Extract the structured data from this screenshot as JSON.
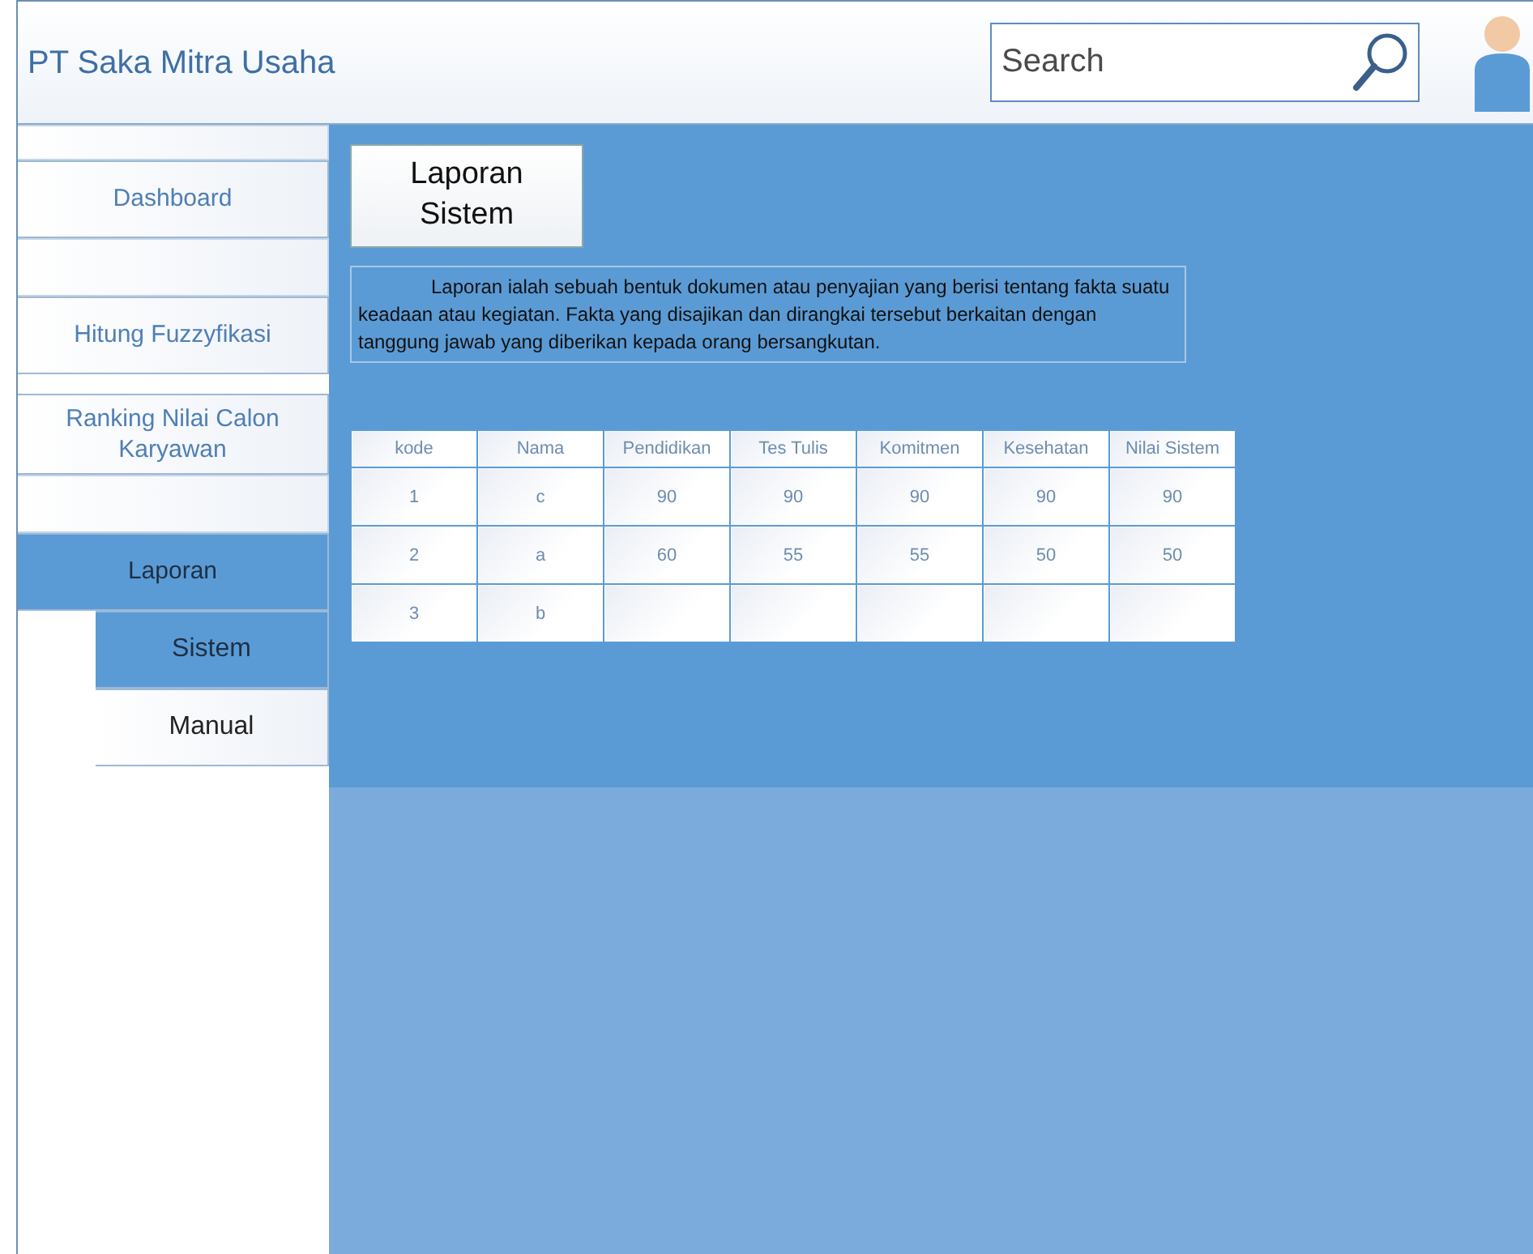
{
  "header": {
    "title": "PT Saka Mitra Usaha",
    "search": {
      "placeholder": "Search"
    }
  },
  "sidebar": {
    "items": [
      {
        "kind": "blank"
      },
      {
        "kind": "item",
        "label": "Dashboard",
        "selected": false
      },
      {
        "kind": "blank"
      },
      {
        "kind": "item",
        "label": "Hitung Fuzzyfikasi",
        "selected": false
      },
      {
        "kind": "item",
        "label": "Ranking Nilai Calon Karyawan",
        "selected": false
      },
      {
        "kind": "blank"
      },
      {
        "kind": "item",
        "label": "Laporan",
        "selected": true,
        "children": [
          {
            "label": "Sistem",
            "selected": true
          },
          {
            "label": "Manual",
            "selected": false
          }
        ]
      }
    ]
  },
  "content": {
    "title": "Laporan Sistem",
    "description": "Laporan ialah sebuah bentuk dokumen atau penyajian yang berisi tentang fakta suatu keadaan atau kegiatan. Fakta yang disajikan dan dirangkai tersebut berkaitan dengan tanggung jawab yang diberikan kepada orang bersangkutan.",
    "table": {
      "columns": [
        "kode",
        "Nama",
        "Pendidikan",
        "Tes Tulis",
        "Komitmen",
        "Kesehatan",
        "Nilai Sistem"
      ],
      "rows": [
        [
          "1",
          "c",
          "90",
          "90",
          "90",
          "90",
          "90"
        ],
        [
          "2",
          "a",
          "60",
          "55",
          "55",
          "50",
          "50"
        ],
        [
          "3",
          "b",
          "",
          "",
          "",
          "",
          ""
        ]
      ]
    }
  }
}
